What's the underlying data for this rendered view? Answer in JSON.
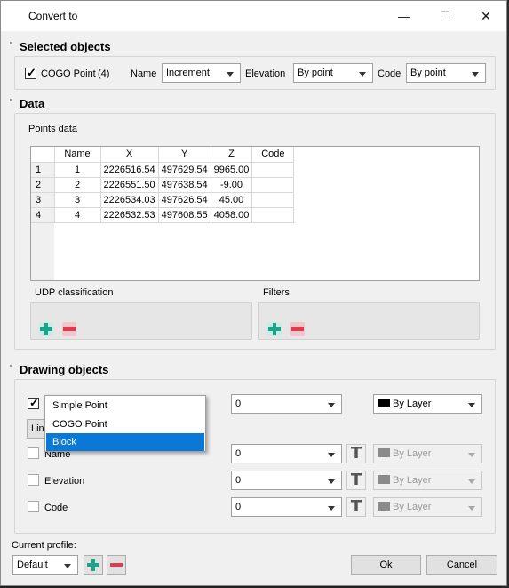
{
  "window": {
    "title": "Convert to",
    "minimize": "—",
    "maximize": "☐",
    "close": "✕"
  },
  "selected_objects": {
    "header": "Selected objects",
    "object_label": "COGO Point",
    "count": "(4)",
    "name_label": "Name",
    "name_value": "Increment",
    "elevation_label": "Elevation",
    "elevation_value": "By point",
    "code_label": "Code",
    "code_value": "By point"
  },
  "data": {
    "header": "Data",
    "points_label": "Points data",
    "columns": [
      "",
      "Name",
      "X",
      "Y",
      "Z",
      "Code"
    ],
    "rows": [
      [
        "1",
        "1",
        "2226516.54",
        "497629.54",
        "9965.00",
        ""
      ],
      [
        "2",
        "2",
        "2226551.50",
        "497638.54",
        "-9.00",
        ""
      ],
      [
        "3",
        "3",
        "2226534.03",
        "497626.54",
        "45.00",
        ""
      ],
      [
        "4",
        "4",
        "2226532.53",
        "497608.55",
        "4058.00",
        ""
      ]
    ],
    "udp_label": "UDP classification",
    "filters_label": "Filters"
  },
  "drawing": {
    "header": "Drawing objects",
    "type_options": [
      "Simple Point",
      "COGO Point",
      "Block"
    ],
    "selected_type": "Block",
    "line_button_label": "Lin",
    "rows": [
      {
        "label": "",
        "value": "0",
        "color": "By Layer"
      },
      {
        "label": "Name",
        "value": "0",
        "color": "By Layer"
      },
      {
        "label": "Elevation",
        "value": "0",
        "color": "By Layer"
      },
      {
        "label": "Code",
        "value": "0",
        "color": "By Layer"
      }
    ],
    "text_style_icon": "T"
  },
  "profile": {
    "label": "Current profile:",
    "value": "Default"
  },
  "buttons": {
    "ok": "Ok",
    "cancel": "Cancel"
  },
  "colors": {
    "accent_plus": "#1aa58b",
    "accent_minus": "#e03c50",
    "selection": "#0a78d7"
  }
}
